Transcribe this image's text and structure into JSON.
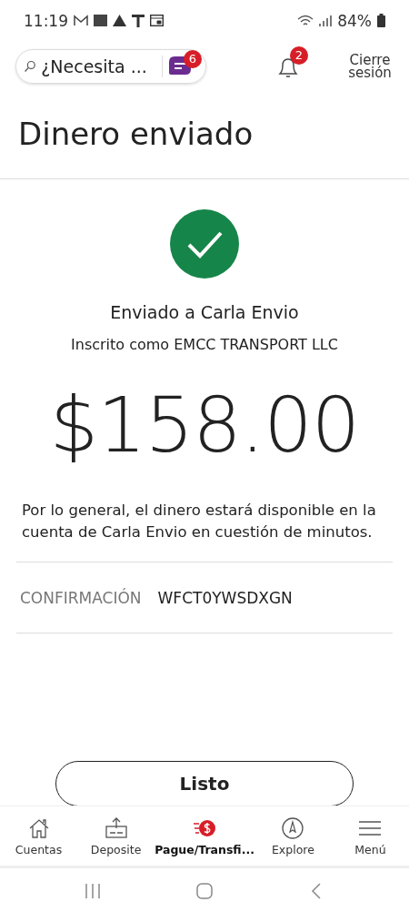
{
  "status_bar": {
    "time": "11:19",
    "battery": "84%"
  },
  "header": {
    "search": {
      "placeholder": "¿Necesita ..."
    },
    "chat_badge": "6",
    "notification_badge": "2",
    "sign_out": "Cierre sesión"
  },
  "title": "Dinero enviado",
  "confirmation": {
    "sent_to": "Enviado a Carla Envio",
    "enrolled_as": "Inscrito como EMCC TRANSPORT LLC",
    "amount": "$158.00",
    "note": "Por lo general, el dinero estará disponible en la cuenta de Carla Envio en cuestión de minutos.",
    "confirmation_label": "CONFIRMACIÓN",
    "confirmation_number": "WFCT0YWSDXGN"
  },
  "done_button": "Listo",
  "bottom_nav": [
    {
      "label": "Cuentas",
      "selected": false
    },
    {
      "label": "Deposite",
      "selected": false
    },
    {
      "label": "Pague/Transfi...",
      "selected": true
    },
    {
      "label": "Explore",
      "selected": false
    },
    {
      "label": "Menú",
      "selected": false
    }
  ]
}
